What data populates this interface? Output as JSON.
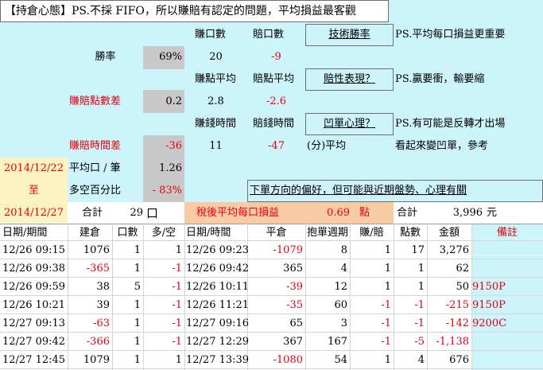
{
  "title": "【持倉心態】PS.不採 FIFO，所以賺賠有認定的問題，平均損益最客觀",
  "summary": {
    "win_count_label": "賺口數",
    "loss_count_label": "賠口數",
    "tech_win_rate": "技術勝率",
    "note1": "PS.平均每口損益更重要",
    "win_rate_label": "勝率",
    "win_rate": "69%",
    "win_count": "20",
    "loss_count": "-9",
    "avg_win_points_label": "賺點平均",
    "avg_loss_points_label": "賠點平均",
    "risk_reward": "賠性表現？",
    "note2": "PS.贏要衝，輸要縮",
    "point_diff_label": "賺賠點數差",
    "point_diff": "0.2",
    "avg_win_points": "2.8",
    "avg_loss_points": "-2.6",
    "win_time_label": "賺錢時間",
    "loss_time_label": "賠錢時間",
    "averaging": "凹單心理？",
    "note3": "PS.有可能是反轉才出場",
    "time_diff_label": "賺賠時間差",
    "time_diff": "-36",
    "win_time": "11",
    "loss_time": "-47",
    "time_unit": "(分)平均",
    "note4": "看起來變凹單，參考",
    "start_date": "2014/12/22",
    "avg_per_lot_label": "平均口 / 筆",
    "avg_per_lot": "1.26",
    "to_label": "至",
    "long_short_label": "多空百分比",
    "long_short": "- 83%",
    "bias_note": "下單方向的偏好，但可能與近期盤勢、心理有關",
    "end_date": "2014/12/27",
    "total_label": "合計",
    "total_trades": "29",
    "total_unit": "口",
    "after_tax_label": "稅後平均每口損益",
    "after_tax_value": "0.69",
    "after_tax_unit": "點",
    "grand_total_label": "合計",
    "grand_total": "3,996",
    "grand_total_unit": "元"
  },
  "table": {
    "headers": [
      "日期/期間",
      "建倉",
      "口數",
      "多/空",
      "日期/時間",
      "平倉",
      "抱單週期",
      "賺/賠",
      "點數",
      "金額",
      "備註"
    ],
    "rows": [
      {
        "open_time": "12/26 09:15",
        "entry": "1076",
        "qty": "1",
        "direction": "1",
        "close_time": "12/26 09:23",
        "exit": "-1079",
        "hold": "8",
        "win_loss": "1",
        "points": "17",
        "amount": "3,276",
        "remark": ""
      },
      {
        "open_time": "12/26 09:38",
        "entry": "-365",
        "qty": "1",
        "direction": "-1",
        "close_time": "12/26 09:42",
        "exit": "365",
        "hold": "4",
        "win_loss": "1",
        "points": "1",
        "amount": "62",
        "remark": ""
      },
      {
        "open_time": "12/26 09:59",
        "entry": "38",
        "qty": "5",
        "direction": "-1",
        "close_time": "12/26 10:11",
        "exit": "-39",
        "hold": "12",
        "win_loss": "1",
        "points": "1",
        "amount": "50",
        "remark": "9150P"
      },
      {
        "open_time": "12/26 10:21",
        "entry": "39",
        "qty": "1",
        "direction": "-1",
        "close_time": "12/26 11:21",
        "exit": "-35",
        "hold": "60",
        "win_loss": "-1",
        "points": "-1",
        "amount": "-215",
        "remark": "9150P"
      },
      {
        "open_time": "12/27 09:13",
        "entry": "-63",
        "qty": "1",
        "direction": "-1",
        "close_time": "12/27 09:16",
        "exit": "65",
        "hold": "3",
        "win_loss": "-1",
        "points": "-1",
        "amount": "-142",
        "remark": "9200C"
      },
      {
        "open_time": "12/27 09:42",
        "entry": "-366",
        "qty": "1",
        "direction": "-1",
        "close_time": "12/27 12:29",
        "exit": "367",
        "hold": "167",
        "win_loss": "-1",
        "points": "-5",
        "amount": "-1,138",
        "remark": ""
      },
      {
        "open_time": "12/27 12:45",
        "entry": "1079",
        "qty": "1",
        "direction": "1",
        "close_time": "12/27 13:39",
        "exit": "-1080",
        "hold": "54",
        "win_loss": "1",
        "points": "4",
        "amount": "676",
        "remark": ""
      }
    ]
  }
}
